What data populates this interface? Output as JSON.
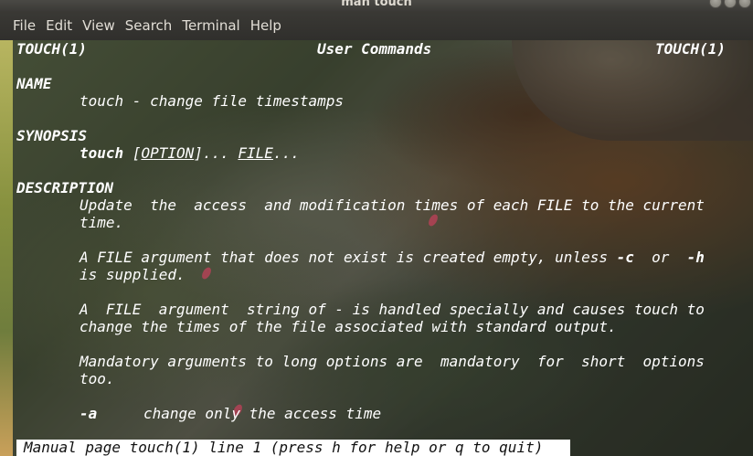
{
  "window": {
    "title": "man touch"
  },
  "menu": [
    "File",
    "Edit",
    "View",
    "Search",
    "Terminal",
    "Help"
  ],
  "man": {
    "header_left": "TOUCH(1)",
    "header_center": "User Commands",
    "header_right": "TOUCH(1)",
    "name_heading": "NAME",
    "name_line": "touch - change file timestamps",
    "synopsis_heading": "SYNOPSIS",
    "synopsis_cmd": "touch",
    "synopsis_sep1": " [",
    "synopsis_option": "OPTION",
    "synopsis_sep2": "]... ",
    "synopsis_file": "FILE",
    "synopsis_end": "...",
    "description_heading": "DESCRIPTION",
    "desc_p1_l1": "Update  the  access  and modification times of each FILE to the current",
    "desc_p1_l2": "time.",
    "desc_p2_l1_a": "A FILE argument that does not exist is created empty, unless ",
    "desc_p2_flag_c": "-c",
    "desc_p2_l1_b": "  or  ",
    "desc_p2_flag_h": "-h",
    "desc_p2_l2": "is supplied.",
    "desc_p3_l1": "A  FILE  argument  string of - is handled specially and causes touch to",
    "desc_p3_l2": "change the times of the file associated with standard output.",
    "desc_p4_l1": "Mandatory arguments to long options are  mandatory  for  short  options",
    "desc_p4_l2": "too.",
    "opt_a_flag": "-a",
    "opt_a_desc": "change only the access time"
  },
  "status_line": "Manual page touch(1) line 1 (press h for help or q to quit)"
}
